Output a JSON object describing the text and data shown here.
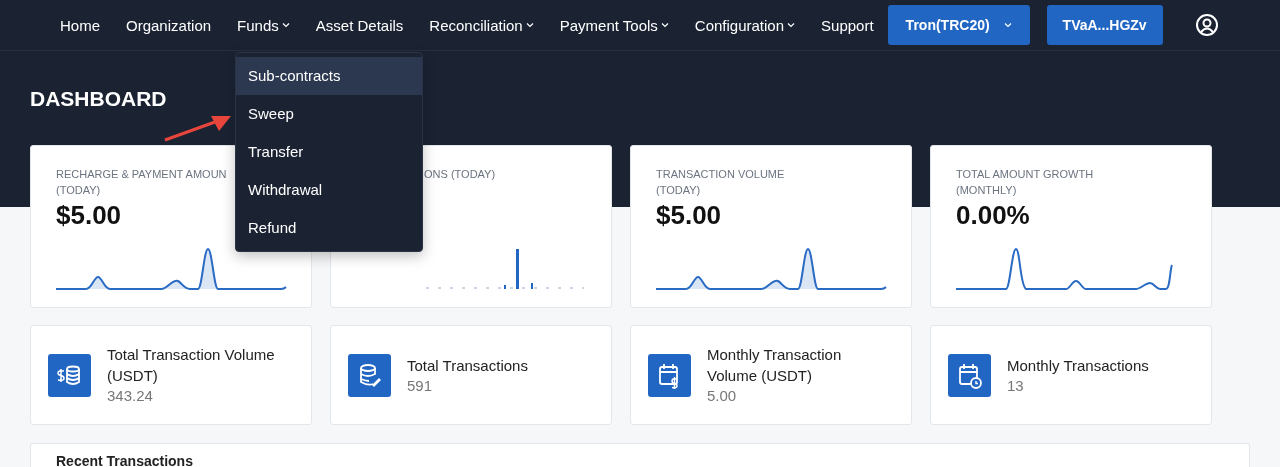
{
  "nav": {
    "items": [
      {
        "label": "Home",
        "dropdown": false
      },
      {
        "label": "Organization",
        "dropdown": false
      },
      {
        "label": "Funds",
        "dropdown": true
      },
      {
        "label": "Asset Details",
        "dropdown": false
      },
      {
        "label": "Reconciliation",
        "dropdown": true
      },
      {
        "label": "Payment Tools",
        "dropdown": true
      },
      {
        "label": "Configuration",
        "dropdown": true
      },
      {
        "label": "Support",
        "dropdown": false
      }
    ],
    "network_button": "Tron(TRC20)",
    "wallet_button": "TVaA...HGZv"
  },
  "dropdown": {
    "items": [
      {
        "label": "Sub-contracts",
        "selected": true
      },
      {
        "label": "Sweep",
        "selected": false
      },
      {
        "label": "Transfer",
        "selected": false
      },
      {
        "label": "Withdrawal",
        "selected": false
      },
      {
        "label": "Refund",
        "selected": false
      }
    ]
  },
  "page_title": "DASHBOARD",
  "chart_cards": [
    {
      "title": "RECHARGE & PAYMENT AMOUN (TODAY)",
      "value": "$5.00",
      "covered": false,
      "kind": "area"
    },
    {
      "title": "ONS (TODAY)",
      "covered": true,
      "kind": "bars"
    },
    {
      "title": "TRANSACTION VOLUME (TODAY)",
      "value": "$5.00",
      "covered": false,
      "kind": "area"
    },
    {
      "title": "TOTAL AMOUNT GROWTH (MONTHLY)",
      "value": "0.00%",
      "covered": false,
      "kind": "line"
    }
  ],
  "stat_cards": [
    {
      "label": "Total Transaction Volume (USDT)",
      "value": "343.24",
      "kind": "coins"
    },
    {
      "label": "Total Transactions",
      "value": "591",
      "kind": "database"
    },
    {
      "label": "Monthly Transaction Volume (USDT)",
      "value": "5.00",
      "kind": "calendar-dollar"
    },
    {
      "label": "Monthly Transactions",
      "value": "13",
      "kind": "calendar-clock"
    }
  ],
  "recent": {
    "title": "Recent Transactions"
  }
}
